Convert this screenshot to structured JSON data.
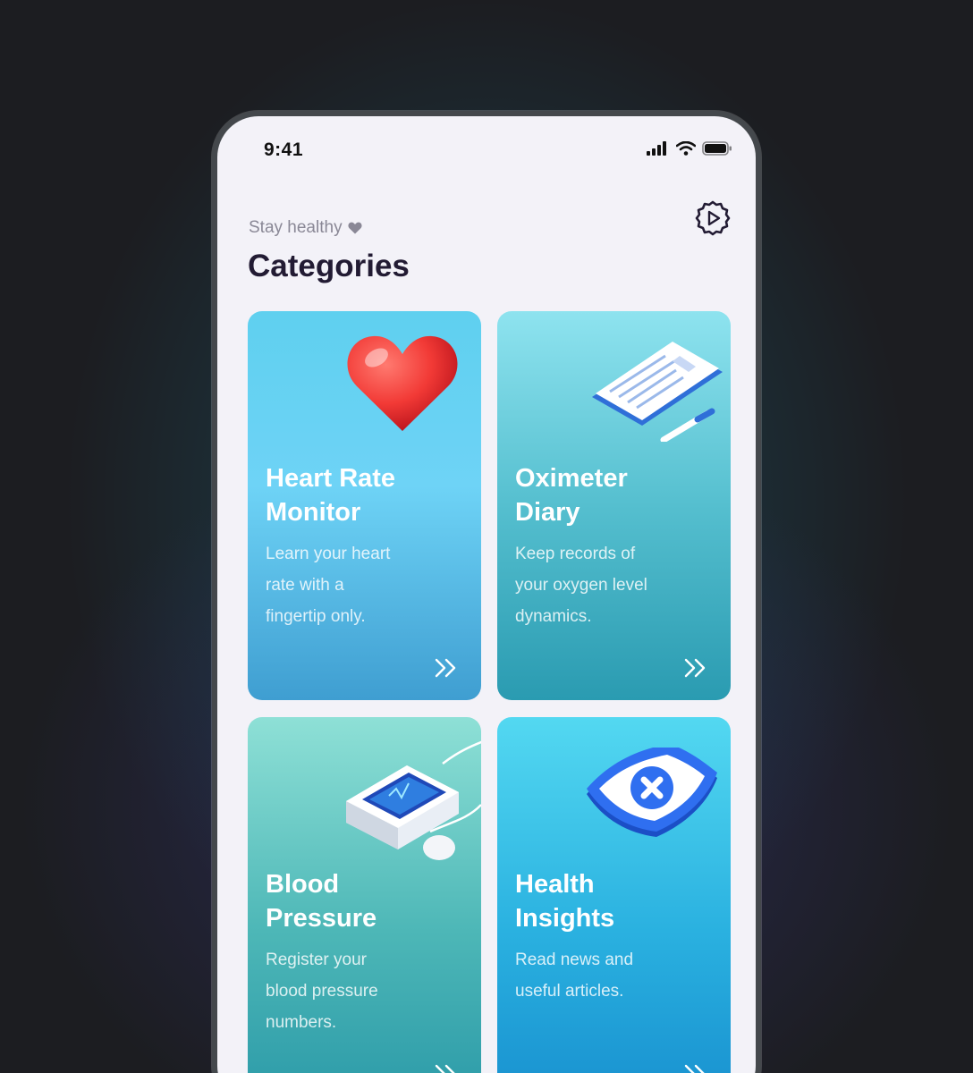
{
  "status_bar": {
    "time": "9:41"
  },
  "header": {
    "subtitle": "Stay healthy",
    "title": "Categories",
    "settings_icon": "gear-play-icon"
  },
  "cards": [
    {
      "title_line1": "Heart Rate",
      "title_line2": "Monitor",
      "desc_line1": "Learn your heart",
      "desc_line2": "rate with a",
      "desc_line3": "fingertip only.",
      "illustration": "heart-icon",
      "arrow": "double-chevron-right-icon"
    },
    {
      "title_line1": "Oximeter",
      "title_line2": "Diary",
      "desc_line1": "Keep records of",
      "desc_line2": "your oxygen level",
      "desc_line3": "dynamics.",
      "illustration": "clipboard-icon",
      "arrow": "double-chevron-right-icon"
    },
    {
      "title_line1": "Blood",
      "title_line2": "Pressure",
      "desc_line1": "Register your",
      "desc_line2": "blood pressure",
      "desc_line3": "numbers.",
      "illustration": "blood-pressure-monitor-icon",
      "arrow": "double-chevron-right-icon"
    },
    {
      "title_line1": "Health",
      "title_line2": "Insights",
      "desc_line1": "Read news and",
      "desc_line2": "useful articles.",
      "desc_line3": "",
      "illustration": "medical-shield-icon",
      "arrow": "double-chevron-right-icon"
    }
  ],
  "colors": {
    "title": "#221b33",
    "subtitle": "#8a8896",
    "screen_bg": "#f3f2f8"
  }
}
